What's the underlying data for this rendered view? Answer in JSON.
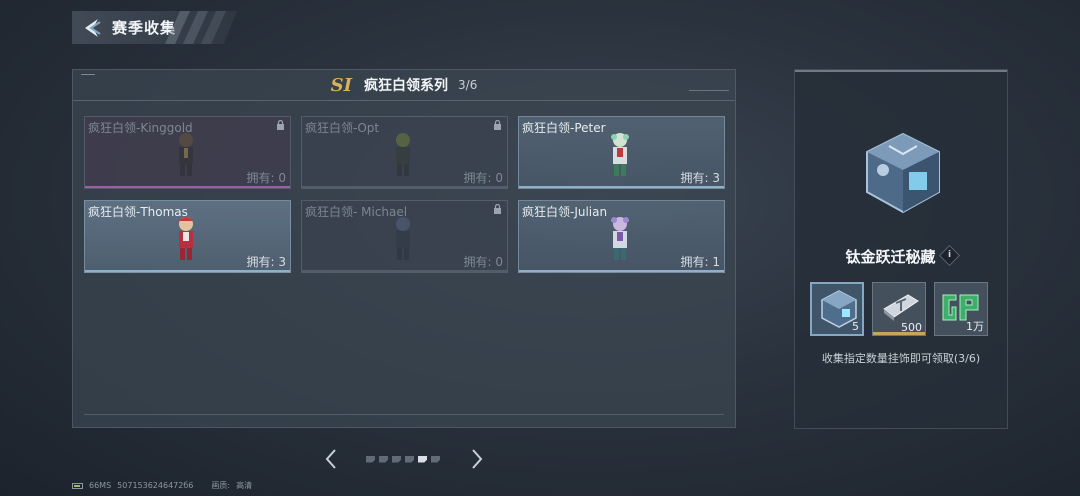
{
  "header": {
    "title": "赛季收集"
  },
  "collection": {
    "logo": "SI",
    "title": "疯狂白领系列",
    "count": "3/6",
    "cards": [
      {
        "name": "疯狂白领-Kinggold",
        "owned": "拥有: 0",
        "locked": true
      },
      {
        "name": "疯狂白领-Opt",
        "owned": "拥有: 0",
        "locked": true
      },
      {
        "name": "疯狂白领-Peter",
        "owned": "拥有: 3",
        "locked": false
      },
      {
        "name": "疯狂白领-Thomas",
        "owned": "拥有: 3",
        "locked": false
      },
      {
        "name": "疯狂白领- Michael",
        "owned": "拥有: 0",
        "locked": true
      },
      {
        "name": "疯狂白领-Julian",
        "owned": "拥有: 1",
        "locked": false
      }
    ]
  },
  "pager": {
    "total": 6,
    "active_index": 4
  },
  "reward": {
    "title": "钛金跃迁秘藏",
    "info_icon": "i",
    "items": [
      {
        "icon": "crystal-box-icon",
        "count": "5"
      },
      {
        "icon": "ticket-icon",
        "count": "500"
      },
      {
        "icon": "gp-coin-icon",
        "count": "1万"
      }
    ],
    "desc": "收集指定数量挂饰即可领取(3/6)"
  },
  "status": {
    "ping": "66MS",
    "uid": "5071536246472б6",
    "quality_label": "画质:",
    "quality_value": "高清"
  }
}
